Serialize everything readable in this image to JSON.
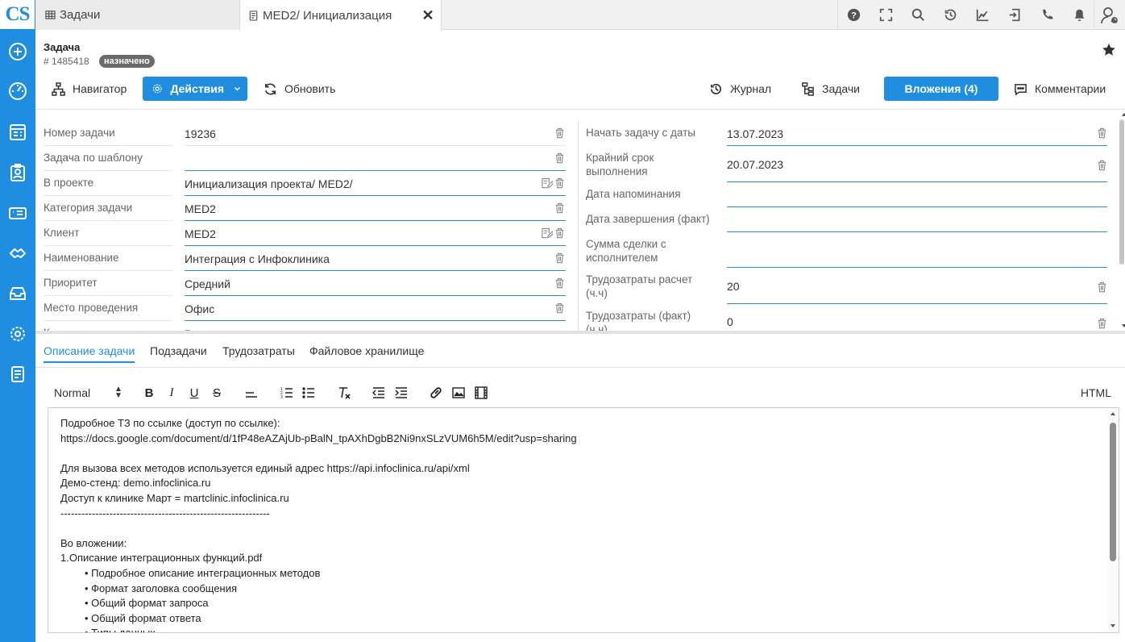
{
  "app": {
    "logo": "CS"
  },
  "tabs": [
    {
      "label": "Задачи"
    },
    {
      "label": "MED2/ Инициализация"
    }
  ],
  "header": {
    "title": "Задача",
    "task_id": "# 1485418",
    "status": "назначено"
  },
  "toolbar": {
    "navigator": "Навигатор",
    "actions": "Действия",
    "refresh": "Обновить",
    "journal": "Журнал",
    "tasks": "Задачи",
    "attachments": "Вложения (4)",
    "comments": "Комментарии"
  },
  "fields_left": [
    {
      "label": "Номер задачи",
      "value": "19236"
    },
    {
      "label": "Задача по шаблону",
      "value": ""
    },
    {
      "label": "В проекте",
      "value": "Инициализация проекта/ MED2/"
    },
    {
      "label": "Категория задачи",
      "value": "MED2"
    },
    {
      "label": "Клиент",
      "value": "MED2"
    },
    {
      "label": "Наименование",
      "value": "Интеграция с Инфоклиника"
    },
    {
      "label": "Приоритет",
      "value": "Средний"
    },
    {
      "label": "Место проведения",
      "value": "Офис"
    },
    {
      "label": "К",
      "value": "Р"
    }
  ],
  "fields_right": [
    {
      "label": "Начать задачу с даты",
      "value": "13.07.2023"
    },
    {
      "label": "Крайний срок выполнения",
      "value": "20.07.2023"
    },
    {
      "label": "Дата напоминания",
      "value": ""
    },
    {
      "label": "Дата завершения (факт)",
      "value": ""
    },
    {
      "label": "Сумма сделки с исполнителем",
      "value": ""
    },
    {
      "label": "Трудозатраты расчет (ч.ч)",
      "value": "20"
    },
    {
      "label": "Трудозатраты (факт) (ч.ч)",
      "value": "0"
    }
  ],
  "bottom_tabs": [
    "Описание задачи",
    "Подзадачи",
    "Трудозатраты",
    "Файловое хранилище"
  ],
  "editor": {
    "format": "Normal",
    "html_label": "HTML",
    "lines": [
      "Подробное ТЗ по ссылке (доступ по ссылке):",
      "https://docs.google.com/document/d/1fP48eAZAjUb-pBalN_tpAXhDgbB2Ni9nxSLzVUM6h5M/edit?usp=sharing",
      "",
      "Для вызова всех методов используется единый адрес https://api.infoclinica.ru/api/xml",
      "Демо-стенд: demo.infoclinica.ru",
      "Доступ к клинике Март = martclinic.infoclinica.ru",
      "------------------------------------------------------------",
      "",
      "Во вложении:",
      "1.Описание интеграционных функций.pdf"
    ],
    "bullets": [
      "• Подробное описание интеграционных методов",
      "• Формат заголовка сообщения",
      "• Общий формат запроса",
      "• Общий формат ответа",
      "• Типы данных"
    ]
  },
  "colors": {
    "accent": "#1f8ee0",
    "badge": "#6b6b6b"
  }
}
